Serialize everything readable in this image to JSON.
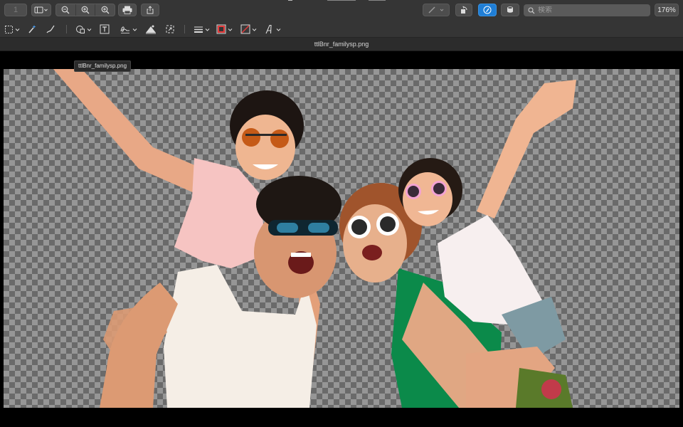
{
  "toolbar": {
    "page_number": "1",
    "search_placeholder": "検索",
    "zoom_level": "176%"
  },
  "document": {
    "title": "ttlBnr_familysp.png",
    "tooltip": "ttlBnr_familysp.png"
  },
  "colors": {
    "toolbar_bg": "#353535",
    "checker_light": "#969696",
    "checker_dark": "#6a6a6a",
    "accent": "#1f7ed6"
  },
  "icons": {
    "sidebar": "sidebar-icon",
    "zoom_out": "zoom-out-icon",
    "zoom_in": "zoom-in-icon",
    "print": "print-icon",
    "share": "share-icon",
    "pen": "pen-icon",
    "rotate": "rotate-icon",
    "markup": "markup-icon",
    "stamp": "stamp-icon",
    "search": "search-icon"
  }
}
